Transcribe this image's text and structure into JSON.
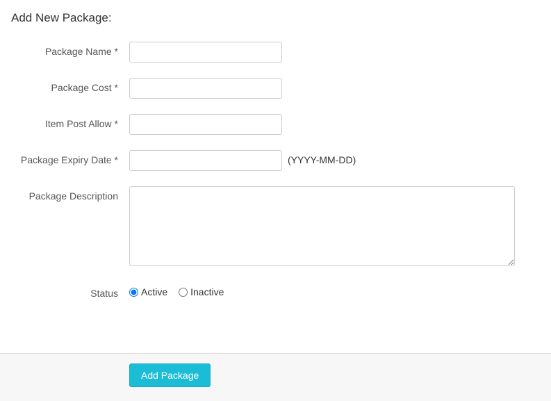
{
  "title": "Add New Package:",
  "fields": {
    "name_label": "Package Name *",
    "name_value": "",
    "cost_label": "Package Cost *",
    "cost_value": "",
    "item_post_label": "Item Post Allow *",
    "item_post_value": "",
    "expiry_label": "Package Expiry Date *",
    "expiry_value": "",
    "expiry_hint": "(YYYY-MM-DD)",
    "description_label": "Package Description",
    "description_value": "",
    "status_label": "Status",
    "status_active_label": "Active",
    "status_inactive_label": "Inactive",
    "status_selected": "active"
  },
  "submit_label": "Add Package"
}
